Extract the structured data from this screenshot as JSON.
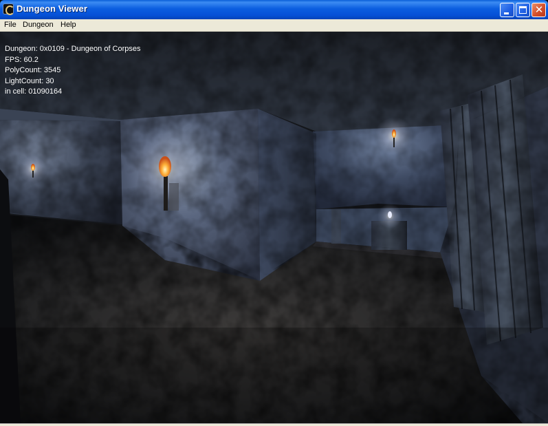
{
  "window": {
    "title": "Dungeon Viewer",
    "title_bar_color": "#0a5fd8",
    "controls": [
      "minimize-icon",
      "maximize-icon",
      "close-icon"
    ],
    "close_glyph": "✕"
  },
  "menu": {
    "file": "File",
    "dungeon": "Dungeon",
    "help": "Help"
  },
  "hud": {
    "dungeon": "Dungeon: 0x0109 - Dungeon of Corpses",
    "fps": "FPS: 60.2",
    "polycount": "PolyCount: 3545",
    "lightcount": "LightCount: 30",
    "cell": "in cell: 01090164"
  },
  "scene": {
    "description_colors": {
      "stone": "#4a5668",
      "floor": "#2a2a2c",
      "torch_flame": "#ffb040",
      "torch_glow": "#fff2c0"
    },
    "torches": 3
  }
}
